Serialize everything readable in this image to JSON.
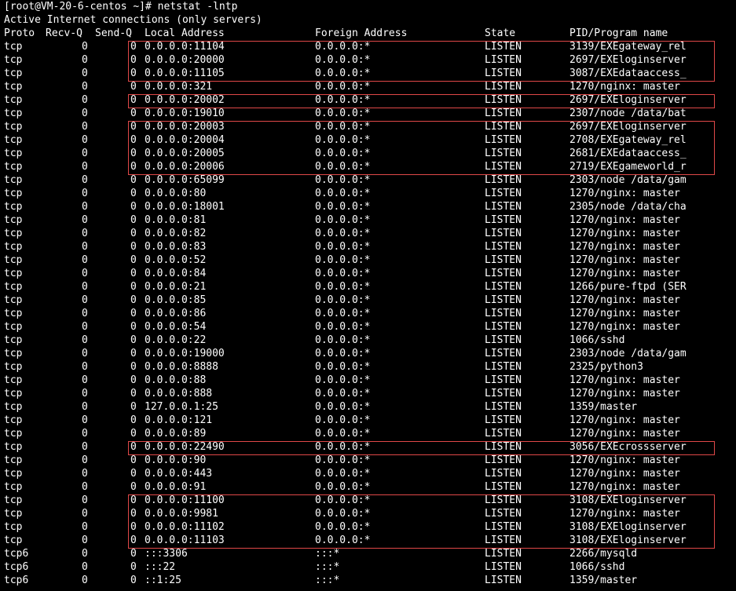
{
  "prompt": "[root@VM-20-6-centos ~]# netstat -lntp",
  "banner": "Active Internet connections (only servers)",
  "headers": {
    "proto": "Proto",
    "recv_q": "Recv-Q",
    "send_q": "Send-Q",
    "local": "Local Address",
    "foreign": "Foreign Address",
    "state": "State",
    "program": "PID/Program name"
  },
  "rows": [
    [
      "tcp",
      "0",
      "0",
      "0.0.0.0:11104",
      "0.0.0.0:*",
      "LISTEN",
      "3139/EXEgateway_rel"
    ],
    [
      "tcp",
      "0",
      "0",
      "0.0.0.0:20000",
      "0.0.0.0:*",
      "LISTEN",
      "2697/EXEloginserver"
    ],
    [
      "tcp",
      "0",
      "0",
      "0.0.0.0:11105",
      "0.0.0.0:*",
      "LISTEN",
      "3087/EXEdataaccess_"
    ],
    [
      "tcp",
      "0",
      "0",
      "0.0.0.0:321",
      "0.0.0.0:*",
      "LISTEN",
      "1270/nginx: master"
    ],
    [
      "tcp",
      "0",
      "0",
      "0.0.0.0:20002",
      "0.0.0.0:*",
      "LISTEN",
      "2697/EXEloginserver"
    ],
    [
      "tcp",
      "0",
      "0",
      "0.0.0.0:19010",
      "0.0.0.0:*",
      "LISTEN",
      "2307/node /data/bat"
    ],
    [
      "tcp",
      "0",
      "0",
      "0.0.0.0:20003",
      "0.0.0.0:*",
      "LISTEN",
      "2697/EXEloginserver"
    ],
    [
      "tcp",
      "0",
      "0",
      "0.0.0.0:20004",
      "0.0.0.0:*",
      "LISTEN",
      "2708/EXEgateway_rel"
    ],
    [
      "tcp",
      "0",
      "0",
      "0.0.0.0:20005",
      "0.0.0.0:*",
      "LISTEN",
      "2681/EXEdataaccess_"
    ],
    [
      "tcp",
      "0",
      "0",
      "0.0.0.0:20006",
      "0.0.0.0:*",
      "LISTEN",
      "2719/EXEgameworld_r"
    ],
    [
      "tcp",
      "0",
      "0",
      "0.0.0.0:65099",
      "0.0.0.0:*",
      "LISTEN",
      "2303/node /data/gam"
    ],
    [
      "tcp",
      "0",
      "0",
      "0.0.0.0:80",
      "0.0.0.0:*",
      "LISTEN",
      "1270/nginx: master"
    ],
    [
      "tcp",
      "0",
      "0",
      "0.0.0.0:18001",
      "0.0.0.0:*",
      "LISTEN",
      "2305/node /data/cha"
    ],
    [
      "tcp",
      "0",
      "0",
      "0.0.0.0:81",
      "0.0.0.0:*",
      "LISTEN",
      "1270/nginx: master"
    ],
    [
      "tcp",
      "0",
      "0",
      "0.0.0.0:82",
      "0.0.0.0:*",
      "LISTEN",
      "1270/nginx: master"
    ],
    [
      "tcp",
      "0",
      "0",
      "0.0.0.0:83",
      "0.0.0.0:*",
      "LISTEN",
      "1270/nginx: master"
    ],
    [
      "tcp",
      "0",
      "0",
      "0.0.0.0:52",
      "0.0.0.0:*",
      "LISTEN",
      "1270/nginx: master"
    ],
    [
      "tcp",
      "0",
      "0",
      "0.0.0.0:84",
      "0.0.0.0:*",
      "LISTEN",
      "1270/nginx: master"
    ],
    [
      "tcp",
      "0",
      "0",
      "0.0.0.0:21",
      "0.0.0.0:*",
      "LISTEN",
      "1266/pure-ftpd (SER"
    ],
    [
      "tcp",
      "0",
      "0",
      "0.0.0.0:85",
      "0.0.0.0:*",
      "LISTEN",
      "1270/nginx: master"
    ],
    [
      "tcp",
      "0",
      "0",
      "0.0.0.0:86",
      "0.0.0.0:*",
      "LISTEN",
      "1270/nginx: master"
    ],
    [
      "tcp",
      "0",
      "0",
      "0.0.0.0:54",
      "0.0.0.0:*",
      "LISTEN",
      "1270/nginx: master"
    ],
    [
      "tcp",
      "0",
      "0",
      "0.0.0.0:22",
      "0.0.0.0:*",
      "LISTEN",
      "1066/sshd"
    ],
    [
      "tcp",
      "0",
      "0",
      "0.0.0.0:19000",
      "0.0.0.0:*",
      "LISTEN",
      "2303/node /data/gam"
    ],
    [
      "tcp",
      "0",
      "0",
      "0.0.0.0:8888",
      "0.0.0.0:*",
      "LISTEN",
      "2325/python3"
    ],
    [
      "tcp",
      "0",
      "0",
      "0.0.0.0:88",
      "0.0.0.0:*",
      "LISTEN",
      "1270/nginx: master"
    ],
    [
      "tcp",
      "0",
      "0",
      "0.0.0.0:888",
      "0.0.0.0:*",
      "LISTEN",
      "1270/nginx: master"
    ],
    [
      "tcp",
      "0",
      "0",
      "127.0.0.1:25",
      "0.0.0.0:*",
      "LISTEN",
      "1359/master"
    ],
    [
      "tcp",
      "0",
      "0",
      "0.0.0.0:121",
      "0.0.0.0:*",
      "LISTEN",
      "1270/nginx: master"
    ],
    [
      "tcp",
      "0",
      "0",
      "0.0.0.0:89",
      "0.0.0.0:*",
      "LISTEN",
      "1270/nginx: master"
    ],
    [
      "tcp",
      "0",
      "0",
      "0.0.0.0:22490",
      "0.0.0.0:*",
      "LISTEN",
      "3056/EXEcrossserver"
    ],
    [
      "tcp",
      "0",
      "0",
      "0.0.0.0:90",
      "0.0.0.0:*",
      "LISTEN",
      "1270/nginx: master"
    ],
    [
      "tcp",
      "0",
      "0",
      "0.0.0.0:443",
      "0.0.0.0:*",
      "LISTEN",
      "1270/nginx: master"
    ],
    [
      "tcp",
      "0",
      "0",
      "0.0.0.0:91",
      "0.0.0.0:*",
      "LISTEN",
      "1270/nginx: master"
    ],
    [
      "tcp",
      "0",
      "0",
      "0.0.0.0:11100",
      "0.0.0.0:*",
      "LISTEN",
      "3108/EXEloginserver"
    ],
    [
      "tcp",
      "0",
      "0",
      "0.0.0.0:9981",
      "0.0.0.0:*",
      "LISTEN",
      "1270/nginx: master"
    ],
    [
      "tcp",
      "0",
      "0",
      "0.0.0.0:11102",
      "0.0.0.0:*",
      "LISTEN",
      "3108/EXEloginserver"
    ],
    [
      "tcp",
      "0",
      "0",
      "0.0.0.0:11103",
      "0.0.0.0:*",
      "LISTEN",
      "3108/EXEloginserver"
    ],
    [
      "tcp6",
      "0",
      "0",
      ":::3306",
      ":::*",
      "LISTEN",
      "2266/mysqld"
    ],
    [
      "tcp6",
      "0",
      "0",
      ":::22",
      ":::*",
      "LISTEN",
      "1066/sshd"
    ],
    [
      "tcp6",
      "0",
      "0",
      "::1:25",
      ":::*",
      "LISTEN",
      "1359/master"
    ]
  ],
  "highlight_groups": [
    {
      "first_row": 0,
      "last_row": 2
    },
    {
      "first_row": 4,
      "last_row": 4
    },
    {
      "first_row": 6,
      "last_row": 9
    },
    {
      "first_row": 30,
      "last_row": 30
    },
    {
      "first_row": 34,
      "last_row": 37
    }
  ],
  "colors": {
    "background": "#000000",
    "text": "#ffffff",
    "highlight_border": "#e04848"
  }
}
